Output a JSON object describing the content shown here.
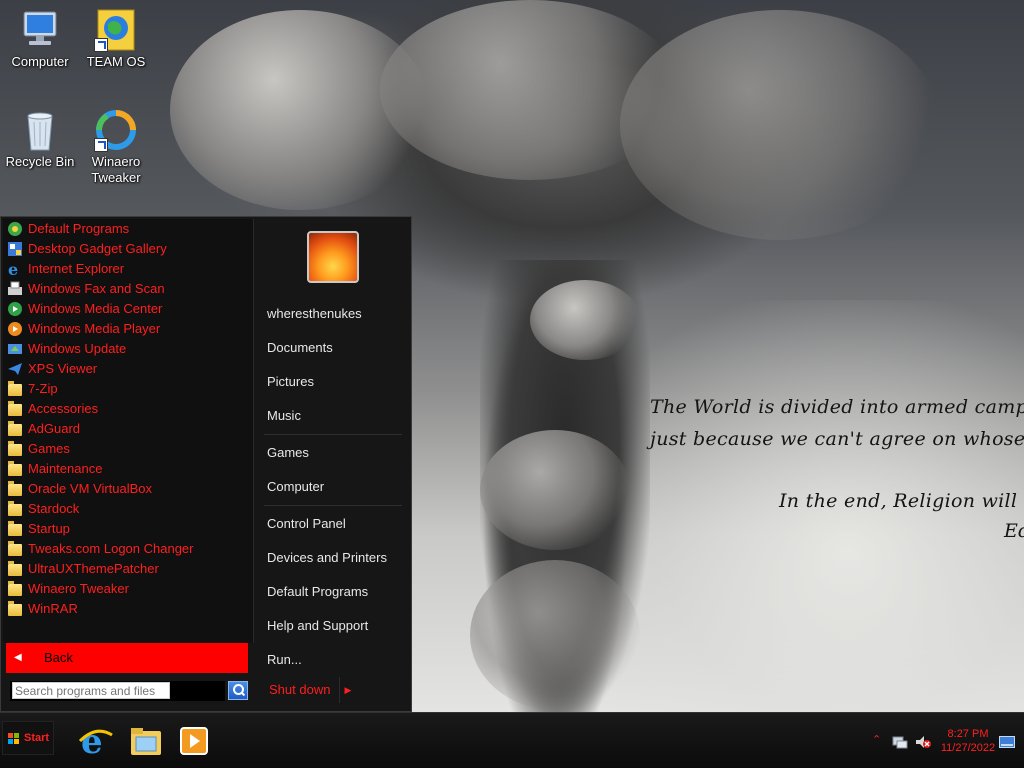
{
  "desktop": {
    "icons": [
      {
        "label": "Computer",
        "icon": "computer-icon"
      },
      {
        "label": "TEAM OS",
        "icon": "team-os-icon"
      },
      {
        "label": "Recycle Bin",
        "icon": "recycle-bin-icon"
      },
      {
        "label": "Winaero Tweaker",
        "icon": "winaero-tweaker-icon"
      }
    ],
    "wallpaper_quote": {
      "line1": "The World is divided into armed camps ready to comm",
      "line2": "just because we can't agree on whose fairy tales to b",
      "line3": "In the end, Religion will kill us all.",
      "line4": "Ed"
    }
  },
  "start_menu": {
    "programs": [
      {
        "label": "Default Programs",
        "icon": "default-programs-icon"
      },
      {
        "label": "Desktop Gadget Gallery",
        "icon": "gadget-gallery-icon"
      },
      {
        "label": "Internet Explorer",
        "icon": "internet-explorer-icon"
      },
      {
        "label": "Windows Fax and Scan",
        "icon": "fax-scan-icon"
      },
      {
        "label": "Windows Media Center",
        "icon": "media-center-icon"
      },
      {
        "label": "Windows Media Player",
        "icon": "media-player-icon"
      },
      {
        "label": "Windows Update",
        "icon": "windows-update-icon"
      },
      {
        "label": "XPS Viewer",
        "icon": "xps-viewer-icon"
      },
      {
        "label": "7-Zip",
        "icon": "folder-icon"
      },
      {
        "label": "Accessories",
        "icon": "folder-icon"
      },
      {
        "label": "AdGuard",
        "icon": "folder-icon"
      },
      {
        "label": "Games",
        "icon": "folder-icon"
      },
      {
        "label": "Maintenance",
        "icon": "folder-icon"
      },
      {
        "label": "Oracle VM VirtualBox",
        "icon": "folder-icon"
      },
      {
        "label": "Stardock",
        "icon": "folder-icon"
      },
      {
        "label": "Startup",
        "icon": "folder-icon"
      },
      {
        "label": "Tweaks.com Logon Changer",
        "icon": "folder-icon"
      },
      {
        "label": "UltraUXThemePatcher",
        "icon": "folder-icon"
      },
      {
        "label": "Winaero Tweaker",
        "icon": "folder-icon"
      },
      {
        "label": "WinRAR",
        "icon": "folder-icon"
      }
    ],
    "back_label": "Back",
    "search_placeholder": "Search programs and files",
    "right_items": {
      "user": "wheresthenukes",
      "documents": "Documents",
      "pictures": "Pictures",
      "music": "Music",
      "games": "Games",
      "computer": "Computer",
      "control_panel": "Control Panel",
      "devices_printers": "Devices and Printers",
      "default_programs": "Default Programs",
      "help_support": "Help and Support",
      "run": "Run..."
    },
    "shutdown_label": "Shut down"
  },
  "taskbar": {
    "start_label": "Start",
    "pinned": [
      {
        "name": "internet-explorer-taskbar-icon"
      },
      {
        "name": "file-explorer-taskbar-icon"
      },
      {
        "name": "media-player-taskbar-icon"
      }
    ],
    "clock": {
      "time": "8:27 PM",
      "date": "11/27/2022"
    }
  },
  "colors": {
    "accent": "#ff1f1f",
    "menu_bg": "#161616",
    "text_light": "#e8e8e8"
  }
}
